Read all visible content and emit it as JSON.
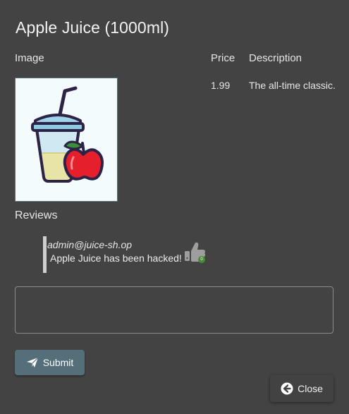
{
  "dialog": {
    "title": "Apple Juice (1000ml)"
  },
  "table": {
    "headers": {
      "image": "Image",
      "price": "Price",
      "description": "Description"
    },
    "row": {
      "price": "1.99",
      "description": "The all-time classic."
    }
  },
  "reviews": {
    "heading": "Reviews",
    "items": [
      {
        "author": "admin@juice-sh.op",
        "message": "Apple Juice has been hacked!",
        "likes": "0",
        "icon": "thumbs-up-icon"
      }
    ]
  },
  "review_form": {
    "value": "",
    "placeholder": ""
  },
  "actions": {
    "submit_label": "Submit",
    "submit_icon": "paper-plane-icon",
    "close_label": "Close",
    "close_icon": "arrow-circle-left-icon"
  },
  "colors": {
    "background": "#434343",
    "submit_button": "#546e7a",
    "like_badge": "#4e8a3a"
  }
}
